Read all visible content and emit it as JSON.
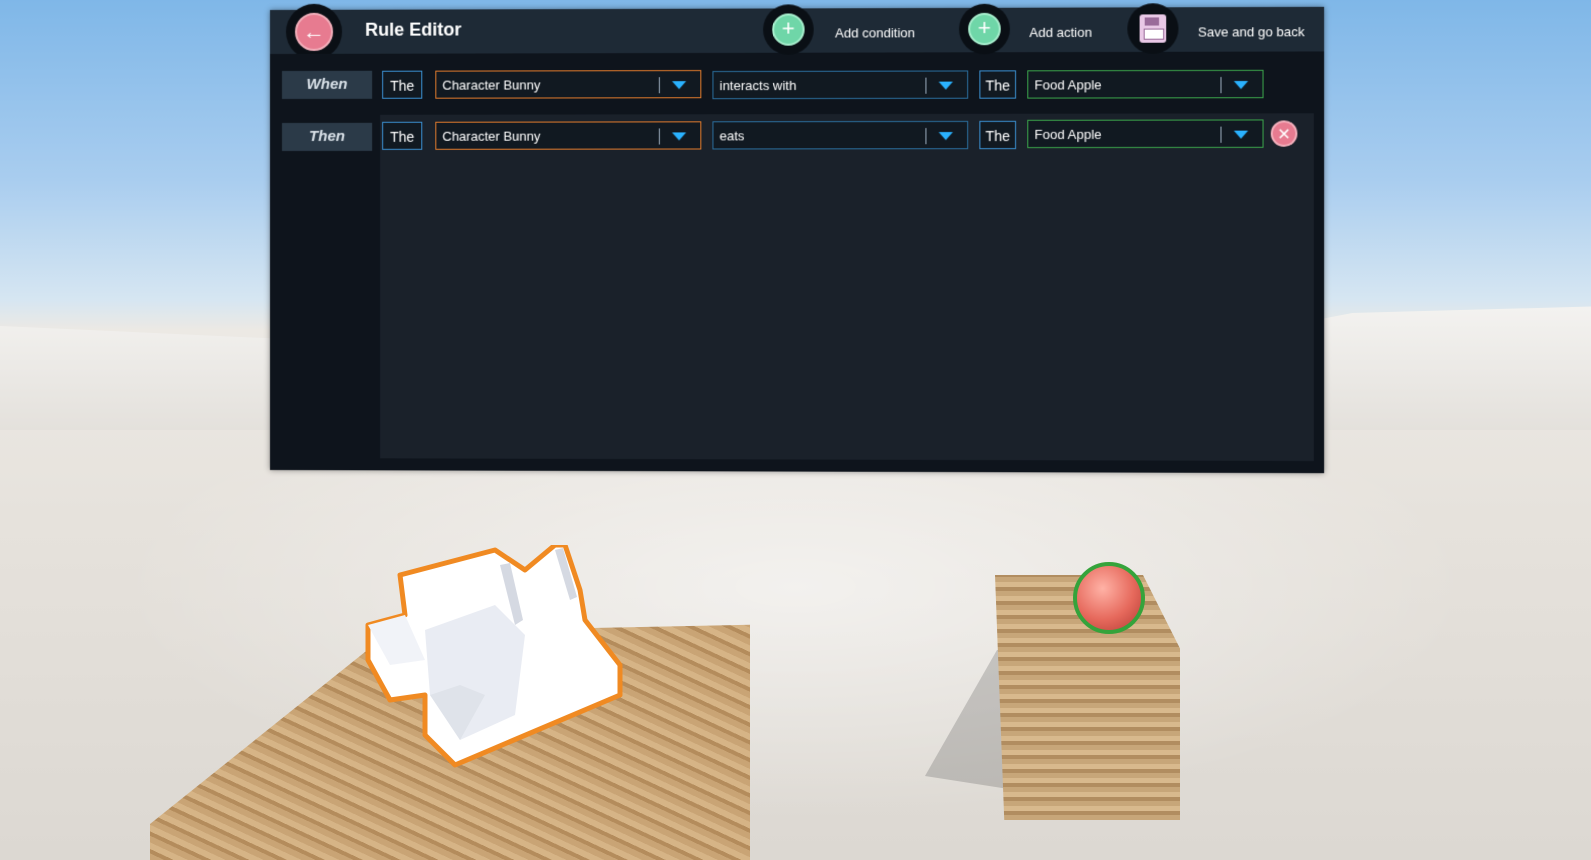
{
  "editor": {
    "title": "Rule Editor",
    "toolbar": {
      "add_condition": "Add condition",
      "add_action": "Add action",
      "save_back": "Save and go back"
    }
  },
  "rows": [
    {
      "label": "When",
      "article_left": "The",
      "subject": "Character Bunny",
      "verb": "interacts with",
      "article_right": "The",
      "object": "Food Apple"
    },
    {
      "label": "Then",
      "article_left": "The",
      "subject": "Character Bunny",
      "verb": "eats",
      "article_right": "The",
      "object": "Food Apple"
    }
  ],
  "colors": {
    "subject_border": "#e07a2c",
    "verb_border": "#2a6d9c",
    "object_border": "#3aa34a",
    "dropdown_arrow": "#2ab2ff",
    "delete_button": "#e77b90",
    "add_button": "#6fd6a8"
  },
  "icons": {
    "back": "back-arrow-icon",
    "add": "plus-icon",
    "save": "floppy-disk-icon",
    "delete": "close-icon",
    "dropdown": "chevron-down-icon"
  }
}
